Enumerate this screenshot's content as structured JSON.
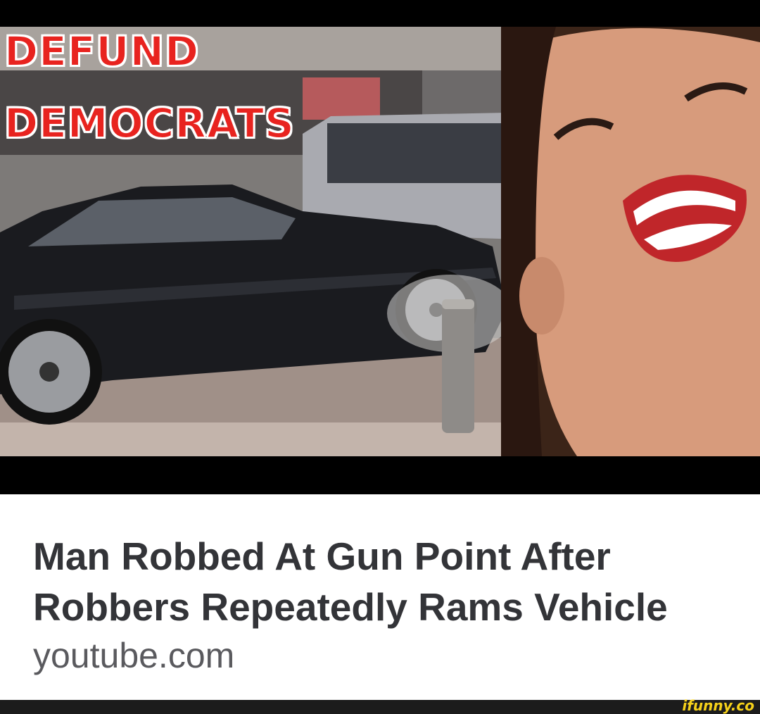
{
  "thumbnail": {
    "overlay_line1": "DEFUND",
    "overlay_line2": "DEMOCRATS",
    "colors": {
      "overlay_text": "#e8231f",
      "overlay_stroke": "#ffffff",
      "letterbox": "#000000"
    }
  },
  "link_card": {
    "headline": "Man Robbed At Gun Point After Robbers Repeatedly Rams Vehicle",
    "domain": "youtube.com"
  },
  "footer": {
    "watermark": "ifunny.co",
    "watermark_color": "#f6d11a"
  }
}
